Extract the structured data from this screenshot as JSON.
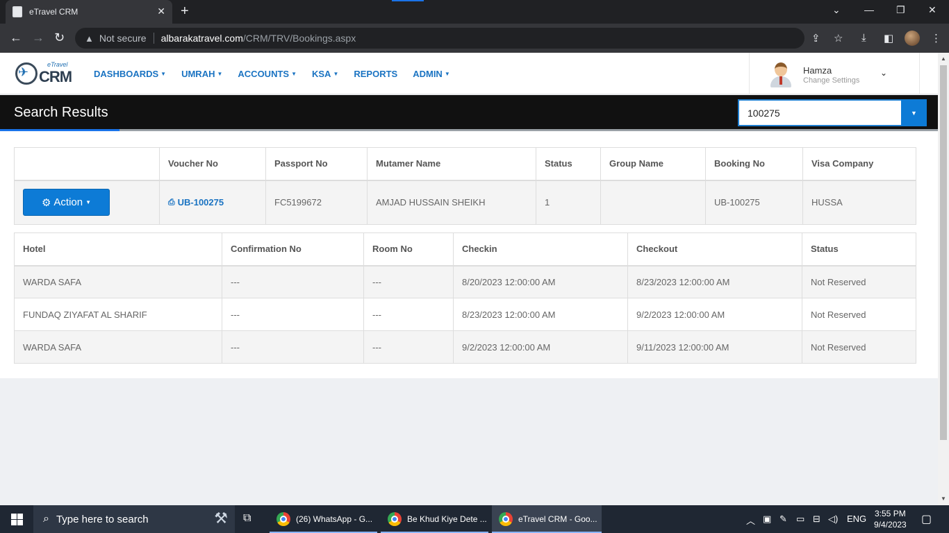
{
  "browser": {
    "tab_title": "eTravel CRM",
    "security_label": "Not secure",
    "url_host": "albarakatravel.com",
    "url_path": "/CRM/TRV/Bookings.aspx"
  },
  "app": {
    "logo_small": "eTravel",
    "logo_big": "CRM",
    "nav": [
      {
        "label": "DASHBOARDS",
        "has_caret": true
      },
      {
        "label": "UMRAH",
        "has_caret": true
      },
      {
        "label": "ACCOUNTS",
        "has_caret": true
      },
      {
        "label": "KSA",
        "has_caret": true
      },
      {
        "label": "REPORTS",
        "has_caret": false
      },
      {
        "label": "ADMIN",
        "has_caret": true
      }
    ],
    "user": {
      "name": "Hamza",
      "subtitle": "Change Settings"
    },
    "accent_color": "#0d7bd6"
  },
  "search": {
    "title": "Search Results",
    "value": "100275"
  },
  "booking_table": {
    "headers": [
      "",
      "Voucher No",
      "Passport No",
      "Mutamer Name",
      "Status",
      "Group Name",
      "Booking No",
      "Visa Company"
    ],
    "action_label": "Action",
    "row": {
      "voucher_no": "UB-100275",
      "passport_no": "FC5199672",
      "mutamer_name": "AMJAD HUSSAIN SHEIKH",
      "status": "1",
      "group_name": "",
      "booking_no": "UB-100275",
      "visa_company": "HUSSA"
    }
  },
  "hotel_table": {
    "headers": [
      "Hotel",
      "Confirmation No",
      "Room No",
      "Checkin",
      "Checkout",
      "Status"
    ],
    "rows": [
      {
        "hotel": "WARDA SAFA",
        "confirmation": "---",
        "room": "---",
        "checkin": "8/20/2023 12:00:00 AM",
        "checkout": "8/23/2023 12:00:00 AM",
        "status": "Not Reserved"
      },
      {
        "hotel": "FUNDAQ ZIYAFAT AL SHARIF",
        "confirmation": "---",
        "room": "---",
        "checkin": "8/23/2023 12:00:00 AM",
        "checkout": "9/2/2023 12:00:00 AM",
        "status": "Not Reserved"
      },
      {
        "hotel": "WARDA SAFA",
        "confirmation": "---",
        "room": "---",
        "checkin": "9/2/2023 12:00:00 AM",
        "checkout": "9/11/2023 12:00:00 AM",
        "status": "Not Reserved"
      }
    ]
  },
  "taskbar": {
    "search_placeholder": "Type here to search",
    "apps": [
      {
        "label": "(26) WhatsApp - G..."
      },
      {
        "label": "Be Khud Kiye Dete ..."
      },
      {
        "label": "eTravel CRM - Goo..."
      }
    ],
    "language": "ENG",
    "time": "3:55 PM",
    "date": "9/4/2023"
  }
}
